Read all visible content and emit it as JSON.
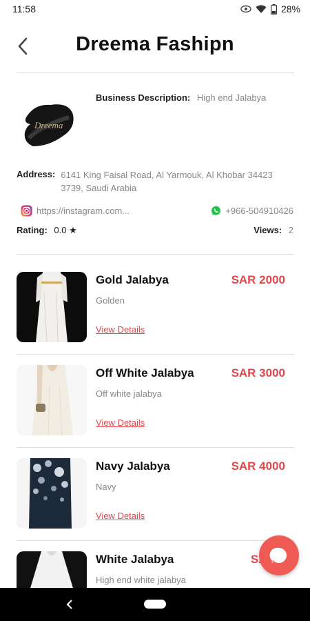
{
  "status_bar": {
    "time": "11:58",
    "battery": "28%",
    "icons": [
      "eye-icon",
      "wifi-icon",
      "battery-icon"
    ]
  },
  "header": {
    "title": "Dreema Fashipn",
    "back_icon": "chevron-left-icon"
  },
  "business": {
    "logo_text": "Dreema",
    "description_label": "Business Description:",
    "description_value": "High end Jalabya",
    "address_label": "Address:",
    "address_value": "6141 King Faisal Road, Al Yarmouk, Al Khobar 34423 3739, Saudi Arabia",
    "instagram": "https://instagram.com...",
    "whatsapp": "+966-504910426",
    "rating_label": "Rating:",
    "rating_value": "0.0 ★",
    "views_label": "Views:",
    "views_value": "2"
  },
  "products": [
    {
      "name": "Gold Jalabya",
      "subtitle": "Golden",
      "price": "SAR 2000",
      "link": "View Details"
    },
    {
      "name": "Off White Jalabya",
      "subtitle": "Off white jalabya",
      "price": "SAR 3000",
      "link": "View Details"
    },
    {
      "name": "Navy Jalabya",
      "subtitle": "Navy",
      "price": "SAR 4000",
      "link": "View Details"
    },
    {
      "name": "White Jalabya",
      "subtitle": "High end white jalabya",
      "price": "SAR 3",
      "link": ""
    }
  ],
  "colors": {
    "accent": "#e2474b",
    "fab": "#ef5a55",
    "muted_text": "#888888",
    "nav_bar": "#000000"
  }
}
